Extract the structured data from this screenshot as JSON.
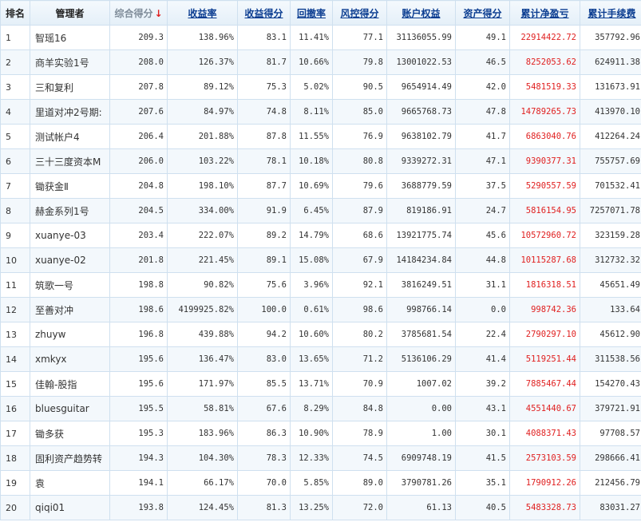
{
  "columns": [
    {
      "label": "排名",
      "style": "plain"
    },
    {
      "label": "管理者",
      "style": "plain"
    },
    {
      "label": "综合得分",
      "style": "sorted",
      "sort_arrow": "↓"
    },
    {
      "label": "收益率",
      "style": "link"
    },
    {
      "label": "收益得分",
      "style": "link"
    },
    {
      "label": "回撤率",
      "style": "link"
    },
    {
      "label": "风控得分",
      "style": "link"
    },
    {
      "label": "账户权益",
      "style": "link"
    },
    {
      "label": "资产得分",
      "style": "link"
    },
    {
      "label": "累计净盈亏",
      "style": "link"
    },
    {
      "label": "累计手续费",
      "style": "link"
    }
  ],
  "rows": [
    [
      "1",
      "智瑶16",
      "209.3",
      "138.96%",
      "83.1",
      "11.41%",
      "77.1",
      "31136055.99",
      "49.1",
      "22914422.72",
      "357792.96"
    ],
    [
      "2",
      "商羊实验1号",
      "208.0",
      "126.37%",
      "81.7",
      "10.66%",
      "79.8",
      "13001022.53",
      "46.5",
      "8252053.62",
      "624911.38"
    ],
    [
      "3",
      "三和复利",
      "207.8",
      "89.12%",
      "75.3",
      "5.02%",
      "90.5",
      "9654914.49",
      "42.0",
      "5481519.33",
      "131673.91"
    ],
    [
      "4",
      "里道对冲2号期:",
      "207.6",
      "84.97%",
      "74.8",
      "8.11%",
      "85.0",
      "9665768.73",
      "47.8",
      "14789265.73",
      "413970.10"
    ],
    [
      "5",
      "测试帐户4",
      "206.4",
      "201.88%",
      "87.8",
      "11.55%",
      "76.9",
      "9638102.79",
      "41.7",
      "6863040.76",
      "412264.24"
    ],
    [
      "6",
      "三十三度资本M",
      "206.0",
      "103.22%",
      "78.1",
      "10.18%",
      "80.8",
      "9339272.31",
      "47.1",
      "9390377.31",
      "755757.69"
    ],
    [
      "7",
      "锄获金Ⅱ",
      "204.8",
      "198.10%",
      "87.7",
      "10.69%",
      "79.6",
      "3688779.59",
      "37.5",
      "5290557.59",
      "701532.41"
    ],
    [
      "8",
      "赫金系列1号",
      "204.5",
      "334.00%",
      "91.9",
      "6.45%",
      "87.9",
      "819186.91",
      "24.7",
      "5816154.95",
      "7257071.78"
    ],
    [
      "9",
      "xuanye-03",
      "203.4",
      "222.07%",
      "89.2",
      "14.79%",
      "68.6",
      "13921775.74",
      "45.6",
      "10572960.72",
      "323159.28"
    ],
    [
      "10",
      "xuanye-02",
      "201.8",
      "221.45%",
      "89.1",
      "15.08%",
      "67.9",
      "14184234.84",
      "44.8",
      "10115287.68",
      "312732.32"
    ],
    [
      "11",
      "筑歌一号",
      "198.8",
      "90.82%",
      "75.6",
      "3.96%",
      "92.1",
      "3816249.51",
      "31.1",
      "1816318.51",
      "45651.49"
    ],
    [
      "12",
      "至善对冲",
      "198.6",
      "4199925.82%",
      "100.0",
      "0.61%",
      "98.6",
      "998766.14",
      "0.0",
      "998742.36",
      "133.64"
    ],
    [
      "13",
      "zhuyw",
      "196.8",
      "439.88%",
      "94.2",
      "10.60%",
      "80.2",
      "3785681.54",
      "22.4",
      "2790297.10",
      "45612.90"
    ],
    [
      "14",
      "xmkyx",
      "195.6",
      "136.47%",
      "83.0",
      "13.65%",
      "71.2",
      "5136106.29",
      "41.4",
      "5119251.44",
      "311538.56"
    ],
    [
      "15",
      "佳翰-股指",
      "195.6",
      "171.97%",
      "85.5",
      "13.71%",
      "70.9",
      "1007.02",
      "39.2",
      "7885467.44",
      "154270.43"
    ],
    [
      "16",
      "bluesguitar",
      "195.5",
      "58.81%",
      "67.6",
      "8.29%",
      "84.8",
      "0.00",
      "43.1",
      "4551440.67",
      "379721.91"
    ],
    [
      "17",
      "锄多获",
      "195.3",
      "183.96%",
      "86.3",
      "10.90%",
      "78.9",
      "1.00",
      "30.1",
      "4088371.43",
      "97708.57"
    ],
    [
      "18",
      "固利资产趋势转",
      "194.3",
      "104.30%",
      "78.3",
      "12.33%",
      "74.5",
      "6909748.19",
      "41.5",
      "2573103.59",
      "298666.41"
    ],
    [
      "19",
      "袁",
      "194.1",
      "66.17%",
      "70.0",
      "5.85%",
      "89.0",
      "3790781.26",
      "35.1",
      "1790912.26",
      "212456.79"
    ],
    [
      "20",
      "qiqi01",
      "193.8",
      "124.45%",
      "81.3",
      "13.25%",
      "72.0",
      "61.13",
      "40.5",
      "5483328.73",
      "83031.27"
    ]
  ],
  "colors": {
    "net_pnl": "#e02020",
    "link": "#0b3d91",
    "sort_arrow": "#e02020"
  }
}
